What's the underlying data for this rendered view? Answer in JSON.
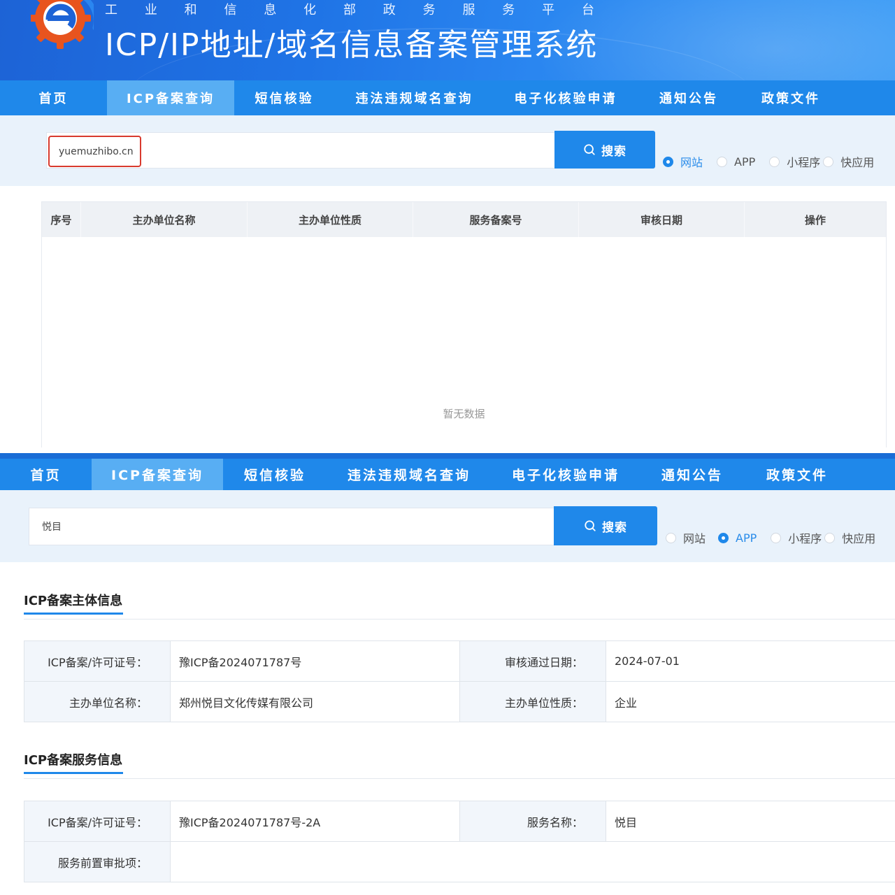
{
  "header": {
    "subtitle_chars": [
      "工",
      "业",
      "和",
      "信",
      "息",
      "化",
      "部",
      "政",
      "务",
      "服",
      "务",
      "平",
      "台"
    ],
    "title": "ICP/IP地址/域名信息备案管理系统",
    "logo_icon": "miit-gear-logo-icon",
    "colors": {
      "banner": "#1f74e6",
      "nav": "#1f88ea",
      "nav_active": "#58aef3",
      "highlight": "#d83a2e"
    }
  },
  "nav": {
    "items": [
      "首页",
      "ICP备案查询",
      "短信核验",
      "违法违规域名查询",
      "电子化核验申请",
      "通知公告",
      "政策文件"
    ],
    "active_index": 1
  },
  "search1": {
    "value": "yuemuzhibo.cn",
    "button_label": "搜索",
    "types": [
      "网站",
      "APP",
      "小程序",
      "快应用"
    ],
    "selected_index": 0
  },
  "results": {
    "columns": [
      "序号",
      "主办单位名称",
      "主办单位性质",
      "服务备案号",
      "审核日期",
      "操作"
    ],
    "empty_text": "暂无数据"
  },
  "search2": {
    "value": "悦目",
    "button_label": "搜索",
    "types": [
      "网站",
      "APP",
      "小程序",
      "快应用"
    ],
    "selected_index": 1
  },
  "subject_info": {
    "title": "ICP备案主体信息",
    "rows": [
      [
        {
          "label": "ICP备案/许可证号：",
          "value": "豫ICP备2024071787号"
        },
        {
          "label": "审核通过日期：",
          "value": "2024-07-01"
        }
      ],
      [
        {
          "label": "主办单位名称：",
          "value": "郑州悦目文化传媒有限公司"
        },
        {
          "label": "主办单位性质：",
          "value": "企业"
        }
      ]
    ]
  },
  "service_info": {
    "title": "ICP备案服务信息",
    "rows": [
      [
        {
          "label": "ICP备案/许可证号：",
          "value": "豫ICP备2024071787号-2A"
        },
        {
          "label": "服务名称：",
          "value": "悦目"
        }
      ],
      [
        {
          "label": "服务前置审批项：",
          "value": ""
        }
      ]
    ]
  }
}
